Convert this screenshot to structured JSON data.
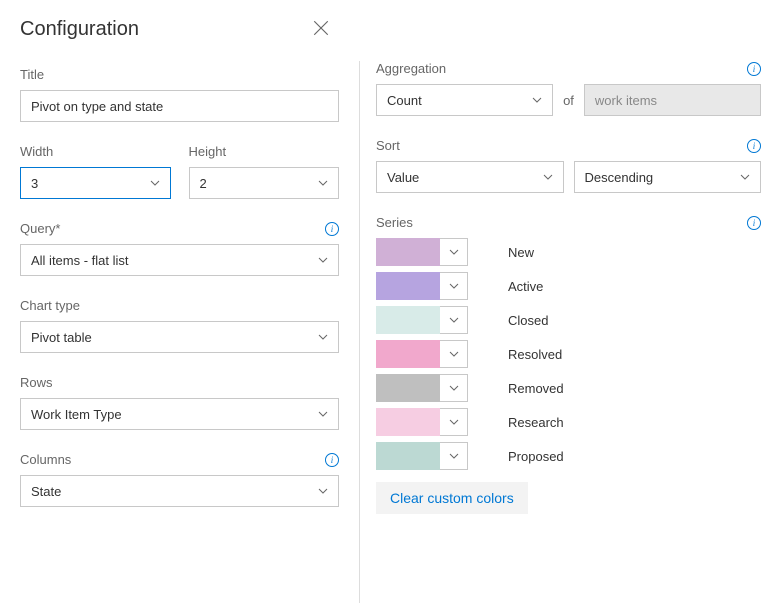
{
  "header": {
    "title": "Configuration"
  },
  "left": {
    "title_label": "Title",
    "title_value": "Pivot on type and state",
    "width_label": "Width",
    "width_value": "3",
    "height_label": "Height",
    "height_value": "2",
    "query_label": "Query*",
    "query_value": "All items - flat list",
    "chart_type_label": "Chart type",
    "chart_type_value": "Pivot table",
    "rows_label": "Rows",
    "rows_value": "Work Item Type",
    "columns_label": "Columns",
    "columns_value": "State"
  },
  "right": {
    "aggregation_label": "Aggregation",
    "aggregation_value": "Count",
    "aggregation_of": "of",
    "aggregation_target": "work items",
    "sort_label": "Sort",
    "sort_by_value": "Value",
    "sort_dir_value": "Descending",
    "series_label": "Series",
    "series": [
      {
        "label": "New",
        "color": "#d0b0d6"
      },
      {
        "label": "Active",
        "color": "#b6a4e0"
      },
      {
        "label": "Closed",
        "color": "#d8ebe8"
      },
      {
        "label": "Resolved",
        "color": "#f1a8cc"
      },
      {
        "label": "Removed",
        "color": "#bfbfbf"
      },
      {
        "label": "Research",
        "color": "#f6cde2"
      },
      {
        "label": "Proposed",
        "color": "#bcd9d3"
      }
    ],
    "clear_colors_label": "Clear custom colors"
  }
}
